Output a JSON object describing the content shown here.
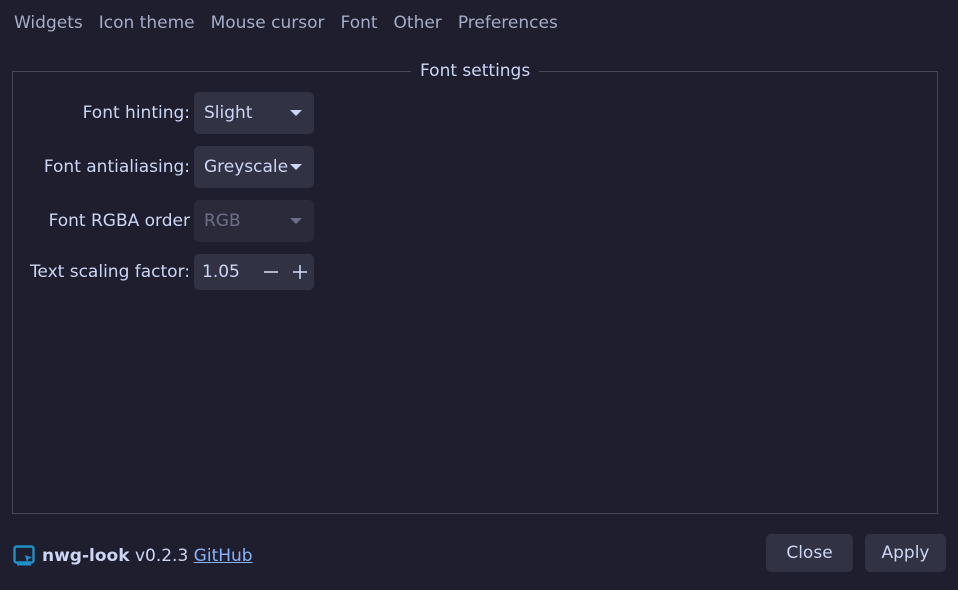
{
  "tabs": [
    {
      "label": "Widgets"
    },
    {
      "label": "Icon theme"
    },
    {
      "label": "Mouse cursor"
    },
    {
      "label": "Font"
    },
    {
      "label": "Other"
    },
    {
      "label": "Preferences"
    }
  ],
  "active_tab": "Font",
  "frame": {
    "title": "Font settings"
  },
  "settings": {
    "hinting": {
      "label": "Font hinting:",
      "value": "Slight"
    },
    "antialiasing": {
      "label": "Font antialiasing:",
      "value": "Greyscale"
    },
    "rgba": {
      "label": "Font RGBA order",
      "value": "RGB",
      "enabled": false
    },
    "scaling": {
      "label": "Text scaling factor:",
      "value": "1.05",
      "minus": "−",
      "plus": "+"
    }
  },
  "footer": {
    "app_name": "nwg-look",
    "version": "v0.2.3",
    "link_label": "GitHub",
    "logo_icon": "nwg-look-logo-icon"
  },
  "buttons": {
    "close_label": "Close",
    "apply_label": "Apply"
  },
  "colors": {
    "background": "#1e1e2e",
    "widget": "#313244",
    "text": "#cdd6f4",
    "muted": "#a6adc8",
    "link": "#89b4fa",
    "logo": "#1e90c8"
  }
}
